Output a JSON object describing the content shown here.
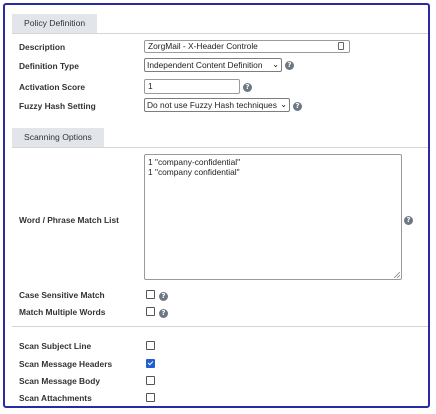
{
  "policy_section": {
    "title": "Policy Definition",
    "description": {
      "label": "Description",
      "value": "ZorgMail - X-Header Controle"
    },
    "definition_type": {
      "label": "Definition Type",
      "selected": "Independent Content Definition"
    },
    "activation_score": {
      "label": "Activation Score",
      "value": "1"
    },
    "fuzzy_hash": {
      "label": "Fuzzy Hash Setting",
      "selected": "Do not use Fuzzy Hash techniques"
    }
  },
  "scanning_section": {
    "title": "Scanning Options",
    "match_list": {
      "label": "Word / Phrase Match List",
      "lines": [
        "1 \"company-confidential\"",
        "1 \"company confidential\""
      ]
    },
    "case_sensitive": {
      "label": "Case Sensitive Match",
      "checked": false
    },
    "match_multiple": {
      "label": "Match Multiple Words",
      "checked": false
    },
    "scan_subject": {
      "label": "Scan Subject Line",
      "checked": false
    },
    "scan_headers": {
      "label": "Scan Message Headers",
      "checked": true
    },
    "scan_body": {
      "label": "Scan Message Body",
      "checked": false
    },
    "scan_attachments": {
      "label": "Scan Attachments",
      "checked": false
    }
  },
  "icons": {
    "help": "help-circle-icon",
    "help_glyph": "?",
    "field_lookup": "field-card-icon",
    "dropdown": "chevron-down-icon",
    "dropdown_glyph": "⌄"
  },
  "colors": {
    "frame_border": "#2a2aa8",
    "section_tab_bg": "#e2e6ea",
    "checkbox_checked": "#1f5fd1",
    "help_icon_bg": "#6d7882"
  }
}
